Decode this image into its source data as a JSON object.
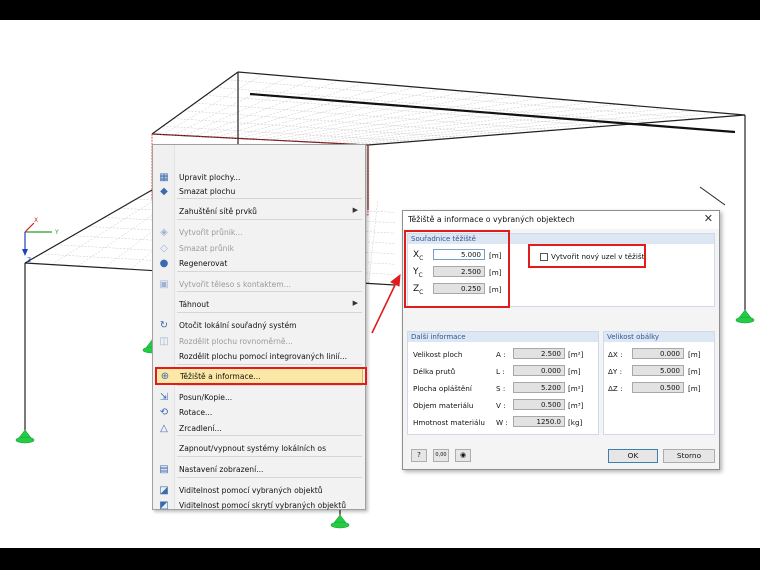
{
  "context_menu": {
    "items": [
      {
        "label": "Upravit plochy...",
        "icon": "edit-surface-icon",
        "disabled": false
      },
      {
        "label": "Smazat plochu",
        "icon": "delete-surface-icon",
        "disabled": false
      },
      {
        "label": "Zahuštění sítě prvků",
        "icon": "",
        "disabled": false,
        "submenu": true
      },
      {
        "label": "Vytvořit průnik...",
        "icon": "intersection-icon",
        "disabled": true
      },
      {
        "label": "Smazat průnik",
        "icon": "delete-intersection-icon",
        "disabled": true
      },
      {
        "label": "Regenerovat",
        "icon": "regenerate-icon",
        "disabled": false
      },
      {
        "label": "Vytvořit těleso s kontaktem...",
        "icon": "solid-contact-icon",
        "disabled": true
      },
      {
        "label": "Táhnout",
        "icon": "",
        "disabled": false,
        "submenu": true
      },
      {
        "label": "Otočit lokální souřadný systém",
        "icon": "rotate-axes-icon",
        "disabled": false
      },
      {
        "label": "Rozdělit plochu rovnoměrně...",
        "icon": "divide-surface-icon",
        "disabled": true
      },
      {
        "label": "Rozdělit plochu pomocí integrovaných linií...",
        "icon": "",
        "disabled": false
      },
      {
        "label": "Těžiště a informace...",
        "icon": "centroid-info-icon",
        "disabled": false,
        "highlighted": true
      },
      {
        "label": "Posun/Kopie...",
        "icon": "move-copy-icon",
        "disabled": false
      },
      {
        "label": "Rotace...",
        "icon": "rotate-icon",
        "disabled": false
      },
      {
        "label": "Zrcadlení...",
        "icon": "mirror-icon",
        "disabled": false
      },
      {
        "label": "Zapnout/vypnout systémy lokálních os",
        "icon": "",
        "disabled": false
      },
      {
        "label": "Nastavení zobrazení...",
        "icon": "display-settings-icon",
        "disabled": false
      },
      {
        "label": "Viditelnost pomocí vybraných objektů",
        "icon": "visibility-selected-icon",
        "disabled": false
      },
      {
        "label": "Viditelnost pomocí skrytí vybraných objektů",
        "icon": "visibility-hide-icon",
        "disabled": false
      }
    ]
  },
  "dialog": {
    "title": "Těžiště a informace o vybraných objektech",
    "centroid": {
      "header": "Souřadnice těžiště",
      "rows": [
        {
          "label": "X",
          "sub": "C",
          "value": "5.000",
          "unit": "[m]"
        },
        {
          "label": "Y",
          "sub": "C",
          "value": "2.500",
          "unit": "[m]"
        },
        {
          "label": "Z",
          "sub": "C",
          "value": "0.250",
          "unit": "[m]"
        }
      ],
      "new_node_label": "Vytvořit nový uzel v těžišti"
    },
    "info": {
      "header": "Další informace",
      "rows": [
        {
          "label": "Velikost ploch",
          "sym": "A :",
          "value": "2.500",
          "unit": "[m²]"
        },
        {
          "label": "Délka prutů",
          "sym": "L :",
          "value": "0.000",
          "unit": "[m]"
        },
        {
          "label": "Plocha opláštění",
          "sym": "S :",
          "value": "5.200",
          "unit": "[m²]"
        },
        {
          "label": "Objem materiálu",
          "sym": "V :",
          "value": "0.500",
          "unit": "[m³]"
        },
        {
          "label": "Hmotnost materiálu",
          "sym": "W :",
          "value": "1250.0",
          "unit": "[kg]"
        }
      ]
    },
    "envelope": {
      "header": "Velikost obálky",
      "rows": [
        {
          "label": "ΔX :",
          "value": "0.000",
          "unit": "[m]"
        },
        {
          "label": "ΔY :",
          "value": "5.000",
          "unit": "[m]"
        },
        {
          "label": "ΔZ :",
          "value": "0.500",
          "unit": "[m]"
        }
      ]
    },
    "ok_label": "OK",
    "cancel_label": "Storno",
    "tool_icons": [
      "help-icon",
      "units-icon",
      "view-icon"
    ],
    "units_icon_text": "0,00"
  },
  "axes": {
    "x": "X",
    "y": "Y",
    "z": "Z"
  },
  "colors": {
    "highlight": "#fce8a6",
    "annotation": "#e01c1c",
    "support": "#22cc44"
  }
}
